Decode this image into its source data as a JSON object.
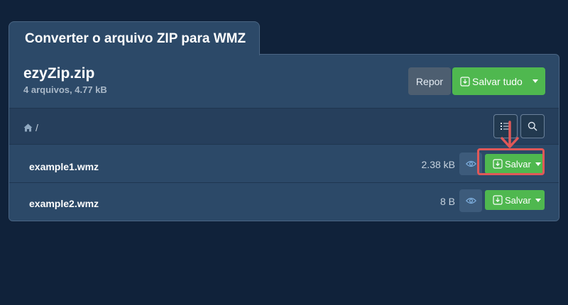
{
  "tab": {
    "title": "Converter o arquivo ZIP para WMZ"
  },
  "archive": {
    "name": "ezyZip.zip",
    "meta": "4 arquivos, 4.77 kB"
  },
  "toolbar": {
    "reset_label": "Repor",
    "save_all_label": "Salvar tudo"
  },
  "path": {
    "separator": "/"
  },
  "files": [
    {
      "name": "example1.wmz",
      "size": "2.38 kB",
      "save_label": "Salvar"
    },
    {
      "name": "example2.wmz",
      "size": "8 B",
      "save_label": "Salvar"
    }
  ],
  "colors": {
    "background": "#10223a",
    "panel": "#2c4968",
    "accent_green": "#4fb84f",
    "highlight_red": "#e05858"
  },
  "icons": [
    "home-icon",
    "list-icon",
    "search-icon",
    "eye-icon",
    "download-icon",
    "caret-down-icon",
    "arrow-down-icon"
  ]
}
